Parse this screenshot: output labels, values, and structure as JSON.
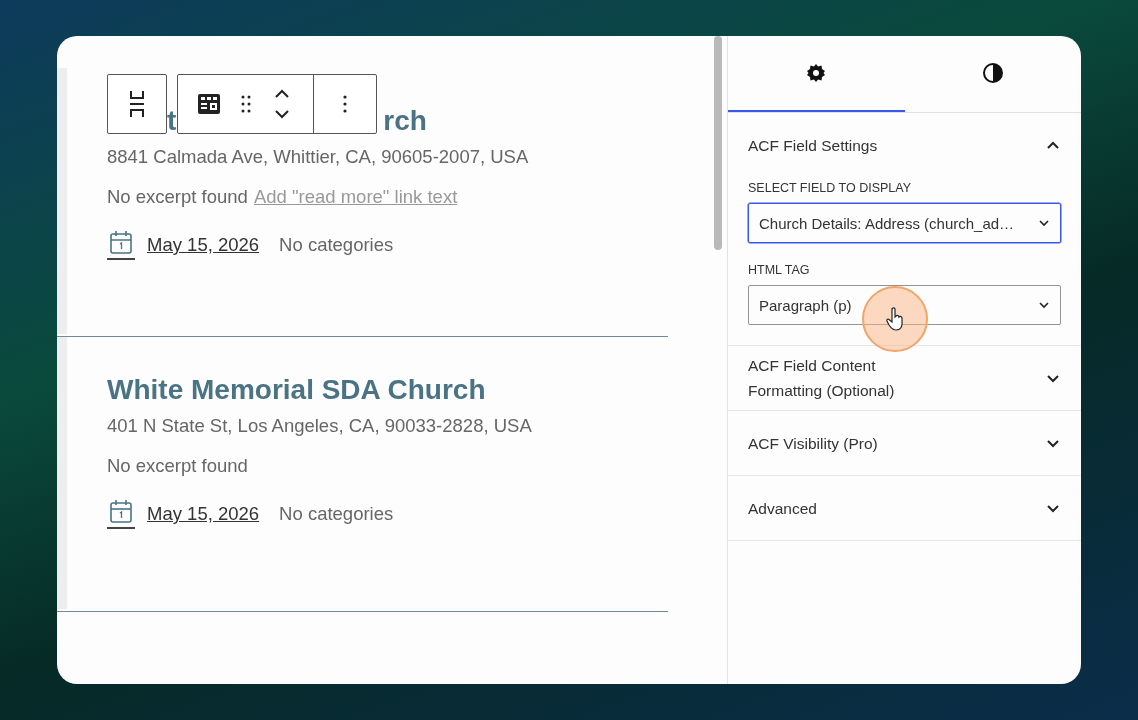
{
  "posts": [
    {
      "title_parts": [
        "t",
        "rch"
      ],
      "address": "8841 Calmada Ave, Whittier, CA, 90605-2007, USA",
      "excerpt": "No excerpt found",
      "read_more_link": "Add \"read more\" link text",
      "date": "May 15, 2026",
      "categories": "No categories",
      "has_toolbar": true
    },
    {
      "title": "White Memorial SDA Church",
      "address": "401 N State St, Los Angeles, CA, 90033-2828, USA",
      "excerpt": "No excerpt found",
      "date": "May 15, 2026",
      "categories": "No categories",
      "has_toolbar": false
    }
  ],
  "sidebar": {
    "tabs": [
      {
        "kind": "settings",
        "selected": true
      },
      {
        "kind": "styles",
        "selected": false
      }
    ],
    "panels": [
      {
        "title": "ACF Field Settings",
        "expanded": true,
        "fields": [
          {
            "label": "SELECT FIELD TO DISPLAY",
            "value": "Church Details: Address (church_ad…",
            "focused": true
          },
          {
            "label": "HTML TAG",
            "value": "Paragraph (p)",
            "focused": false
          }
        ]
      },
      {
        "title": "ACF Field Content Formatting (Optional)",
        "expanded": false
      },
      {
        "title": "ACF Visibility (Pro)",
        "expanded": false
      },
      {
        "title": "Advanced",
        "expanded": false
      }
    ]
  }
}
